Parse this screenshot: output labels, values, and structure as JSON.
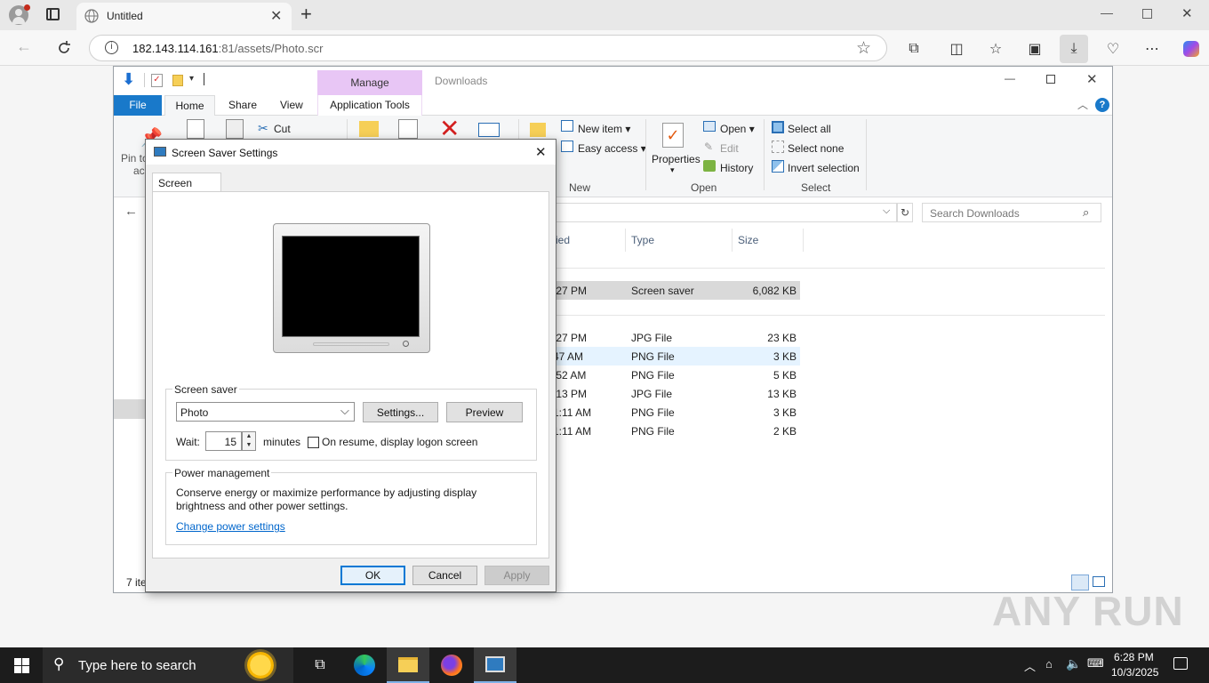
{
  "browser": {
    "tab_title": "Untitled",
    "url_host": "182.143.114.161",
    "url_rest": ":81/assets/Photo.scr"
  },
  "explorer": {
    "qat_context_label": "Manage",
    "window_title": "Downloads",
    "tabs": [
      "File",
      "Home",
      "Share",
      "View",
      "Application Tools"
    ],
    "ribbon": {
      "pin_label_1": "Pin to",
      "pin_label_2": "ac",
      "cut": "Cut",
      "new_item": "New item",
      "easy_access": "Easy access",
      "new_group": "New",
      "properties": "Properties",
      "open": "Open",
      "edit": "Edit",
      "history": "History",
      "open_group": "Open",
      "select_all": "Select all",
      "select_none": "Select none",
      "invert_selection": "Invert selection",
      "select_group": "Select"
    },
    "search_placeholder": "Search Downloads",
    "columns": {
      "modified": "ied",
      "type": "Type",
      "size": "Size"
    },
    "rows": [
      {
        "date": ":27 PM",
        "type": "Screen saver",
        "size": "6,082 KB"
      },
      {
        "date": ":27 PM",
        "type": "JPG File",
        "size": "23 KB"
      },
      {
        "date": "47 AM",
        "type": "PNG File",
        "size": "3 KB"
      },
      {
        "date": ":52 AM",
        "type": "PNG File",
        "size": "5 KB"
      },
      {
        "date": ":13 PM",
        "type": "JPG File",
        "size": "13 KB"
      },
      {
        "date": "1:11 AM",
        "type": "PNG File",
        "size": "3 KB"
      },
      {
        "date": "1:11 AM",
        "type": "PNG File",
        "size": "2 KB"
      }
    ],
    "status": "7 ite"
  },
  "dialog": {
    "title": "Screen Saver Settings",
    "tab": "Screen Saver",
    "screensaver_legend": "Screen saver",
    "selected_saver": "Photo",
    "settings_btn": "Settings...",
    "preview_btn": "Preview",
    "wait_label": "Wait:",
    "wait_value": "15",
    "minutes_label": "minutes",
    "resume_label": "On resume, display logon screen",
    "power_legend": "Power management",
    "power_text_1": "Conserve energy or maximize performance by adjusting display",
    "power_text_2": "brightness and other power settings.",
    "power_link": "Change power settings",
    "ok": "OK",
    "cancel": "Cancel",
    "apply": "Apply"
  },
  "taskbar": {
    "search_placeholder": "Type here to search",
    "time": "6:28 PM",
    "date": "10/3/2025"
  },
  "watermark": "ANY RUN",
  "colors": {
    "accent": "#0078d4",
    "file_tab": "#1979ca",
    "manage_tab": "#e8c6f5",
    "selected_row": "#d9d9d9",
    "hover_row": "#e5f3ff"
  }
}
